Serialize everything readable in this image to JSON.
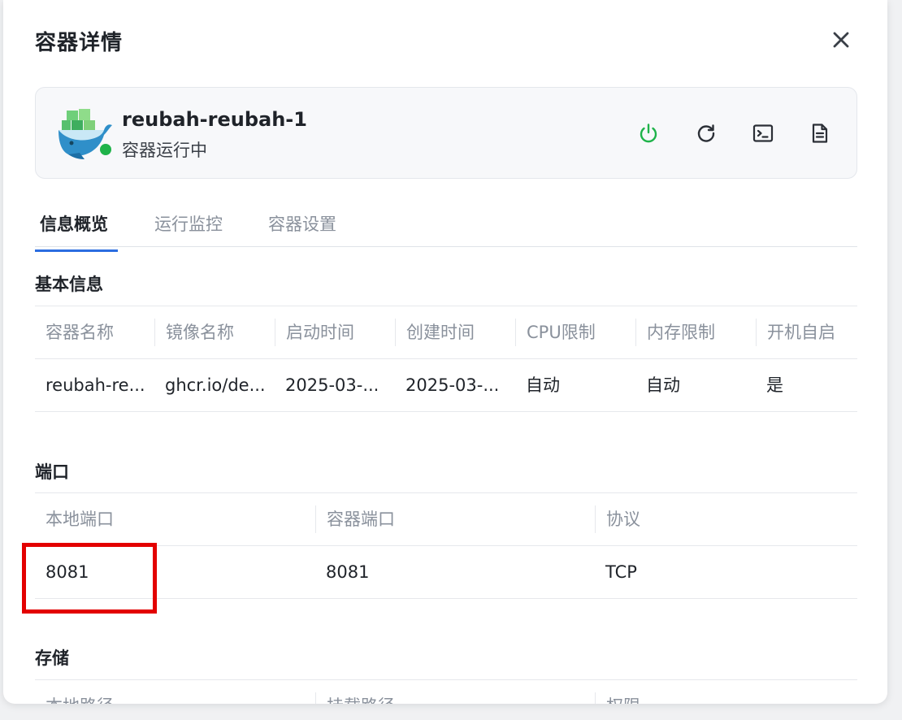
{
  "modal": {
    "title": "容器详情"
  },
  "container": {
    "name": "reubah-reubah-1",
    "status": "容器运行中",
    "status_color": "#1fb34a"
  },
  "actions": {
    "power": "power-icon",
    "restart": "restart-icon",
    "terminal": "terminal-icon",
    "logs": "log-file-icon",
    "power_color": "#1fb34a"
  },
  "tabs": [
    {
      "label": "信息概览",
      "active": true
    },
    {
      "label": "运行监控",
      "active": false
    },
    {
      "label": "容器设置",
      "active": false
    }
  ],
  "basic_info": {
    "title": "基本信息",
    "headers": [
      "容器名称",
      "镜像名称",
      "启动时间",
      "创建时间",
      "CPU限制",
      "内存限制",
      "开机自启"
    ],
    "row": [
      "reubah-re...",
      "ghcr.io/de...",
      "2025-03-...",
      "2025-03-...",
      "自动",
      "自动",
      "是"
    ]
  },
  "ports": {
    "title": "端口",
    "headers": [
      "本地端口",
      "容器端口",
      "协议"
    ],
    "row": [
      "8081",
      "8081",
      "TCP"
    ]
  },
  "storage": {
    "title": "存储",
    "headers": [
      "本地路径",
      "挂载路径",
      "权限"
    ]
  },
  "accent_color": "#2b6de0",
  "highlight_color": "#e30000"
}
